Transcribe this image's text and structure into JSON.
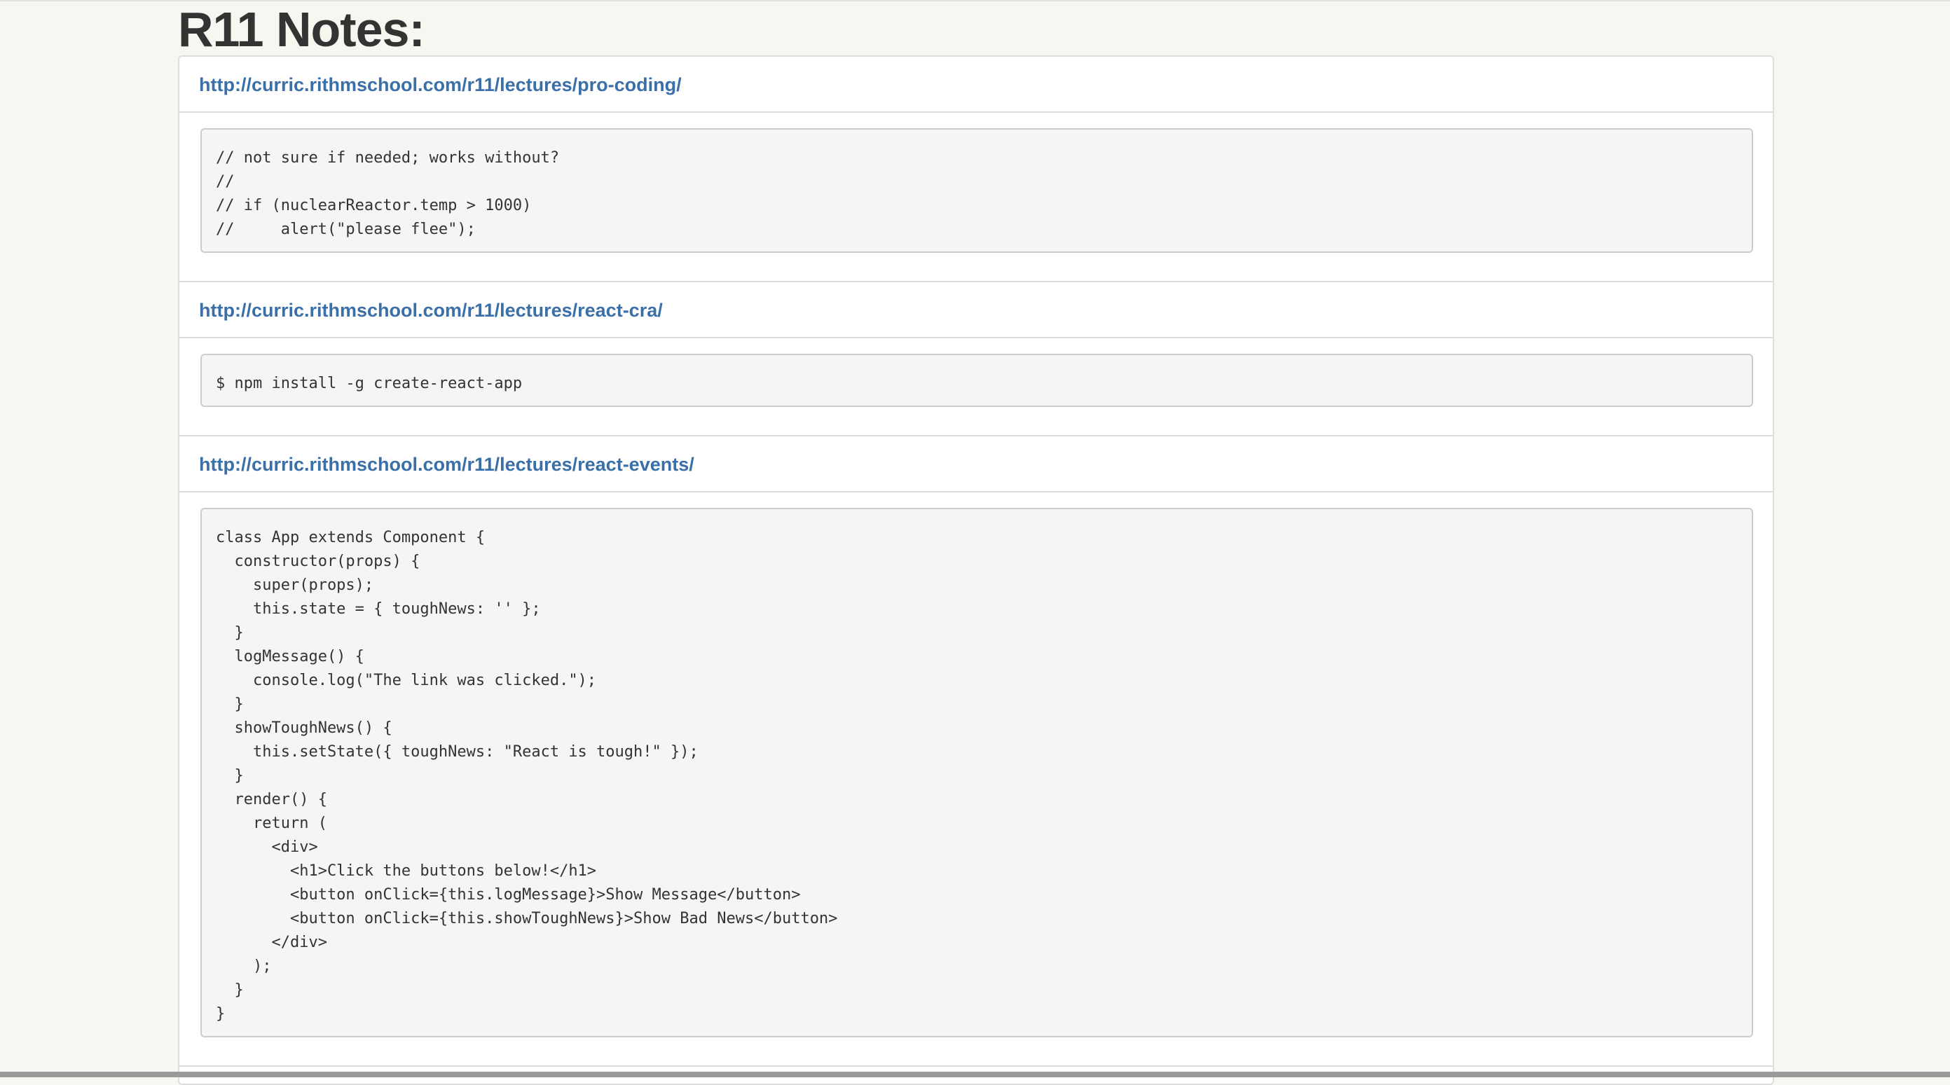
{
  "page": {
    "title": "R11 Notes:"
  },
  "sections": [
    {
      "link": "http://curric.rithmschool.com/r11/lectures/pro-coding/",
      "code": "// not sure if needed; works without?\n//\n// if (nuclearReactor.temp > 1000)\n//     alert(\"please flee\");"
    },
    {
      "link": "http://curric.rithmschool.com/r11/lectures/react-cra/",
      "code": "$ npm install -g create-react-app"
    },
    {
      "link": "http://curric.rithmschool.com/r11/lectures/react-events/",
      "code": "class App extends Component {\n  constructor(props) {\n    super(props);\n    this.state = { toughNews: '' };\n  }\n  logMessage() {\n    console.log(\"The link was clicked.\");\n  }\n  showToughNews() {\n    this.setState({ toughNews: \"React is tough!\" });\n  }\n  render() {\n    return (\n      <div>\n        <h1>Click the buttons below!</h1>\n        <button onClick={this.logMessage}>Show Message</button>\n        <button onClick={this.showToughNews}>Show Bad News</button>\n      </div>\n    );\n  }\n}"
    }
  ],
  "colors": {
    "background": "#f7f6f0",
    "panel": "#ffffff",
    "border": "#dddddd",
    "link": "#3a6fa8",
    "code_background": "#f5f5f5",
    "text": "#333333"
  }
}
